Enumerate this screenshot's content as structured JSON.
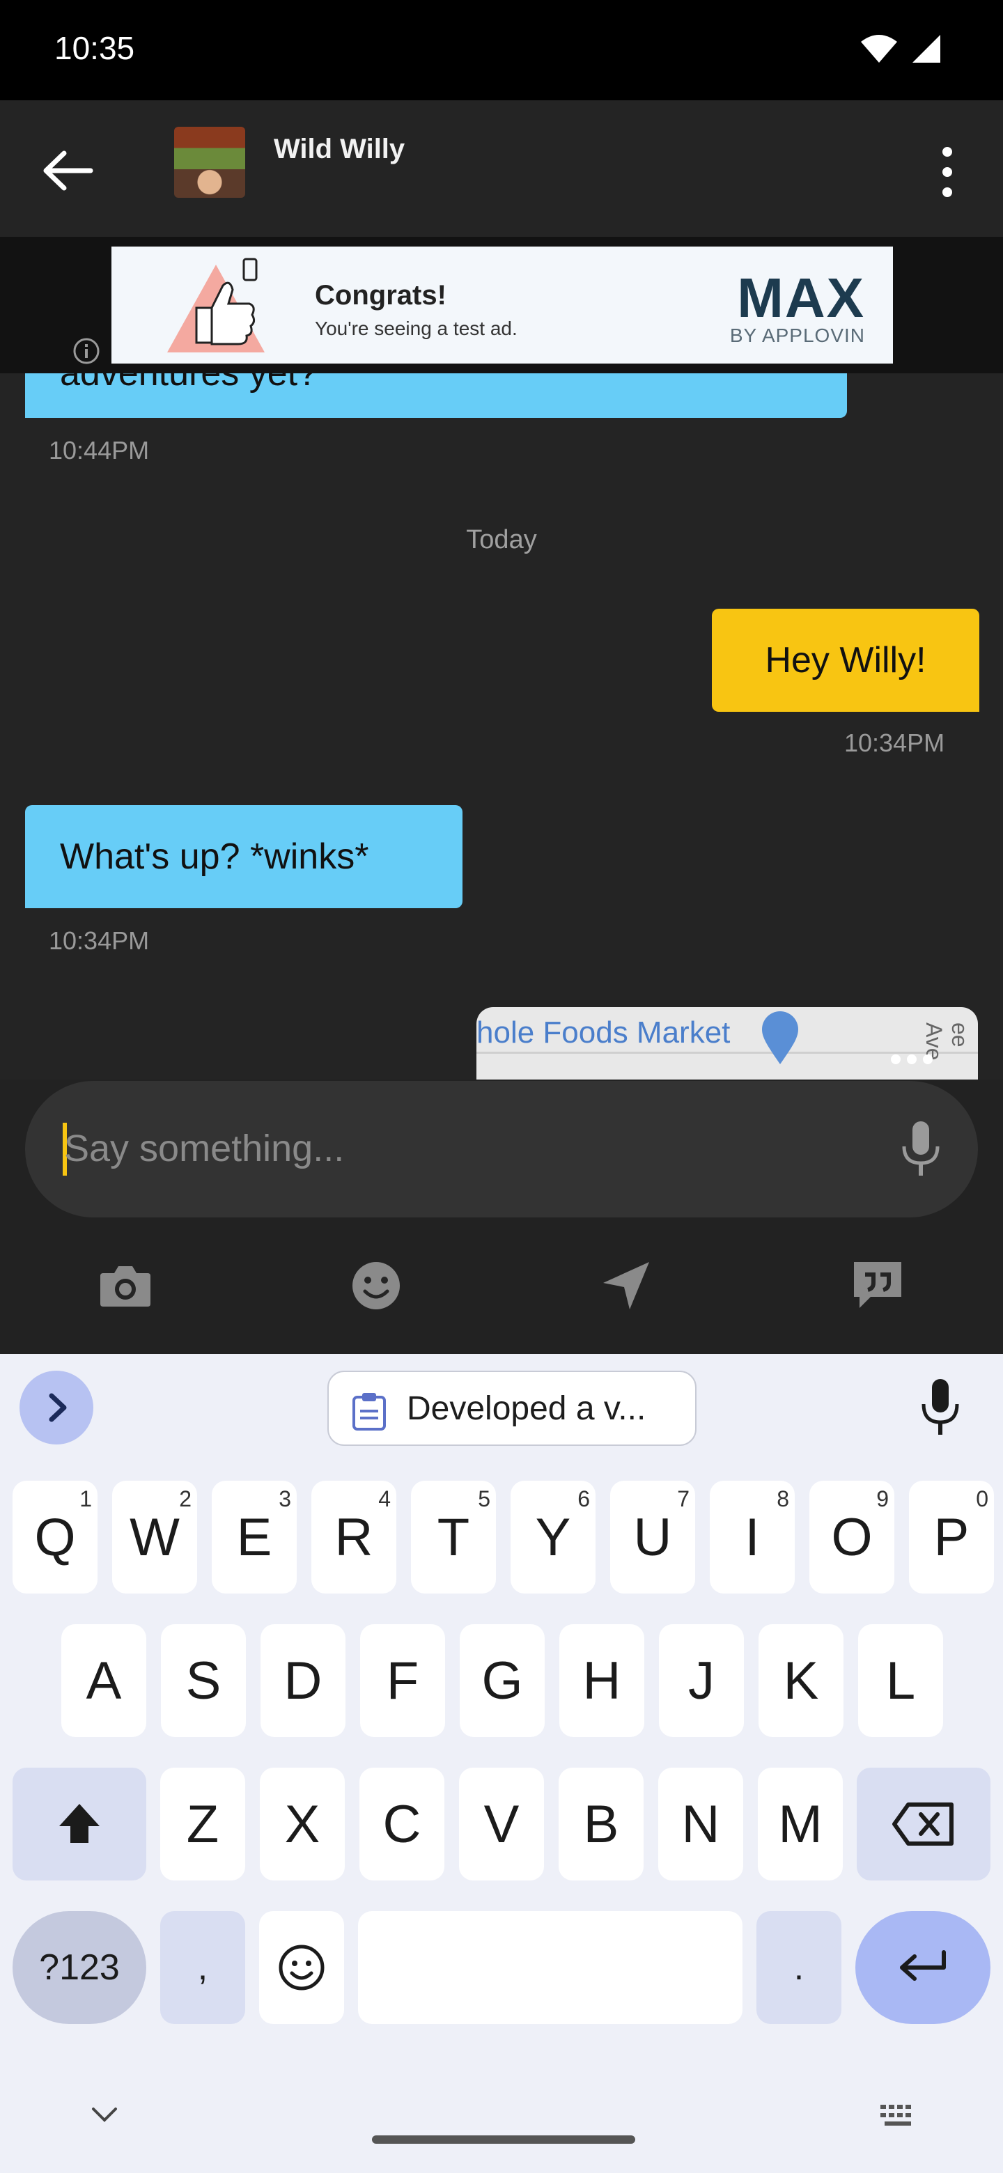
{
  "status_bar": {
    "time": "10:35"
  },
  "header": {
    "contact_name": "Wild Willy"
  },
  "ad": {
    "headline": "Congrats!",
    "subtext": "You're seeing a test ad.",
    "brand": "MAX",
    "brand_sub": "BY APPLOVIN"
  },
  "chat": {
    "partial_message_text": "adventures yet?",
    "partial_message_time": "10:44PM",
    "day_separator": "Today",
    "messages": [
      {
        "from": "me",
        "text": "Hey Willy!",
        "time": "10:34PM"
      },
      {
        "from": "them",
        "text": "What's up? *winks*",
        "time": "10:34PM"
      }
    ],
    "map_preview": {
      "place_label": "hole Foods Market",
      "street_label": "ee Ave"
    }
  },
  "composer": {
    "placeholder": "Say something..."
  },
  "actions": [
    {
      "icon": "camera-icon"
    },
    {
      "icon": "emoji-icon"
    },
    {
      "icon": "location-arrow-icon"
    },
    {
      "icon": "quote-icon"
    }
  ],
  "keyboard": {
    "suggestion": "Developed a v...",
    "row1": [
      {
        "key": "Q",
        "hint": "1"
      },
      {
        "key": "W",
        "hint": "2"
      },
      {
        "key": "E",
        "hint": "3"
      },
      {
        "key": "R",
        "hint": "4"
      },
      {
        "key": "T",
        "hint": "5"
      },
      {
        "key": "Y",
        "hint": "6"
      },
      {
        "key": "U",
        "hint": "7"
      },
      {
        "key": "I",
        "hint": "8"
      },
      {
        "key": "O",
        "hint": "9"
      },
      {
        "key": "P",
        "hint": "0"
      }
    ],
    "row2": [
      "A",
      "S",
      "D",
      "F",
      "G",
      "H",
      "J",
      "K",
      "L"
    ],
    "row3": [
      "Z",
      "X",
      "C",
      "V",
      "B",
      "N",
      "M"
    ],
    "symbols_key": "?123",
    "comma_key": ",",
    "period_key": "."
  },
  "colors": {
    "incoming_bubble": "#67cdf7",
    "outgoing_bubble": "#f8c512",
    "background": "#242424",
    "keyboard_accent": "#b7c2f2"
  }
}
